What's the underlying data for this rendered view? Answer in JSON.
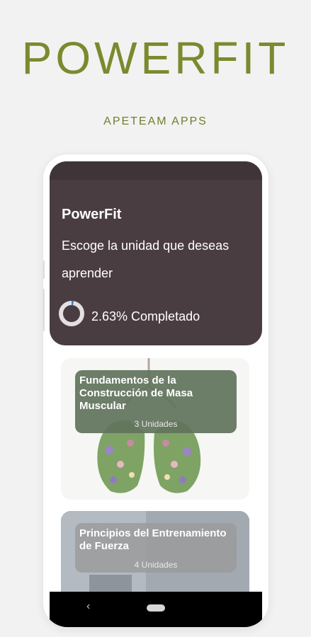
{
  "promo": {
    "brand": "POWERFIT",
    "developer": "APETEAM APPS"
  },
  "app": {
    "title": "PowerFit",
    "subtitle": "Escoge la unidad que deseas aprender",
    "progress": {
      "percent": 2.63,
      "label": "2.63% Completado"
    }
  },
  "cards": [
    {
      "title": "Fundamentos de la Construcción de Masa Muscular",
      "units": "3 Unidades"
    },
    {
      "title": "Principios del Entrenamiento de Fuerza",
      "units": "4 Unidades"
    }
  ],
  "navbar": {
    "back_icon": "back-chevron-icon",
    "home_icon": "home-pill-icon"
  },
  "colors": {
    "brand": "#7a8a2e",
    "header_bg": "#4a3d42",
    "card_label": "#61735c",
    "progress_fill": "#2f7fd8"
  }
}
